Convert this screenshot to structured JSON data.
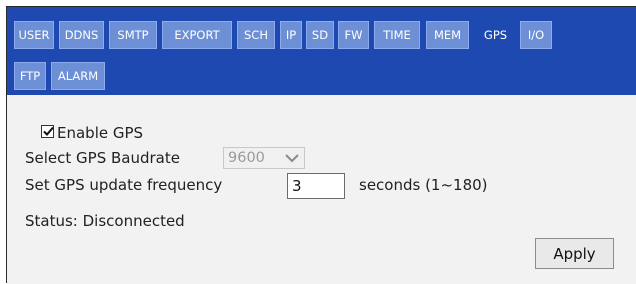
{
  "tabs": [
    {
      "label": "USER",
      "active": false
    },
    {
      "label": "DDNS",
      "active": false
    },
    {
      "label": "SMTP",
      "active": false
    },
    {
      "label": "EXPORT",
      "active": false
    },
    {
      "label": "SCH",
      "active": false
    },
    {
      "label": "IP",
      "active": false
    },
    {
      "label": "SD",
      "active": false
    },
    {
      "label": "FW",
      "active": false
    },
    {
      "label": "TIME",
      "active": false
    },
    {
      "label": "MEM",
      "active": false
    },
    {
      "label": "GPS",
      "active": true
    },
    {
      "label": "I/O",
      "active": false
    },
    {
      "label": "FTP",
      "active": false
    },
    {
      "label": "ALARM",
      "active": false
    }
  ],
  "gps": {
    "enable_label": "Enable GPS",
    "enabled": true,
    "baudrate_label": "Select GPS Baudrate",
    "baudrate_value": "9600",
    "frequency_label": "Set GPS update frequency",
    "frequency_value": "3",
    "frequency_unit": "seconds (1~180)",
    "status_text": "Status: Disconnected",
    "apply_label": "Apply"
  },
  "colors": {
    "tabbar": "#1d49b0",
    "tab": "#6d8fd6",
    "content_bg": "#f2f2f2"
  }
}
